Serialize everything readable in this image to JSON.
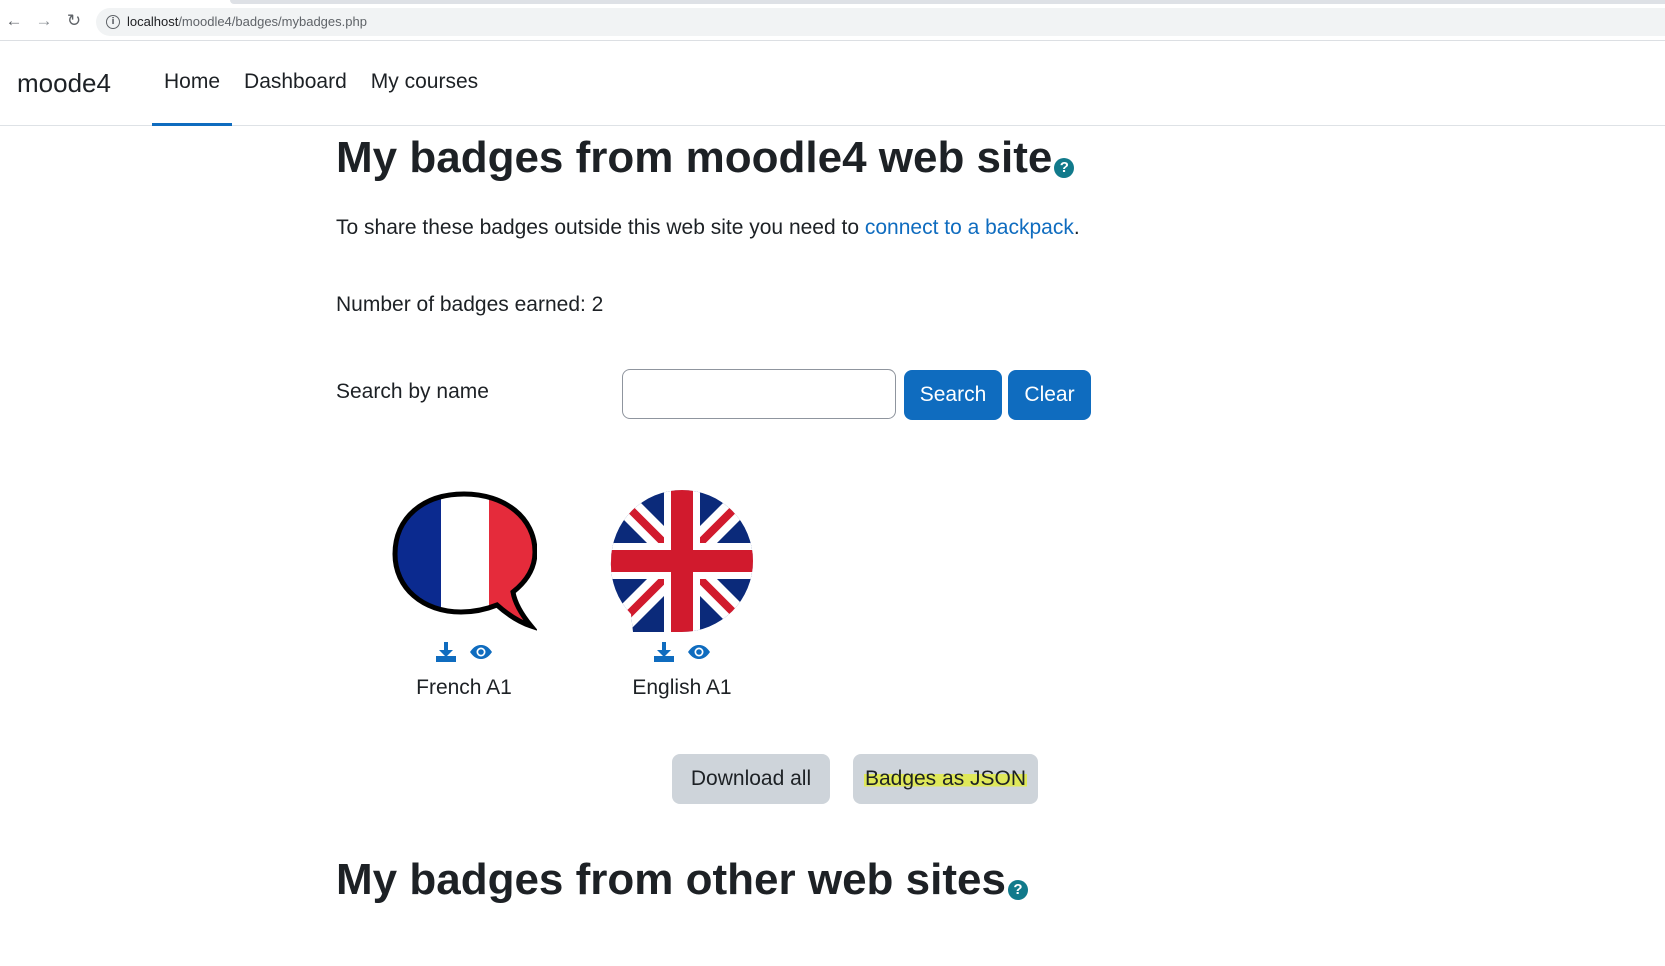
{
  "browser": {
    "url_host": "localhost",
    "url_path": "/moodle4/badges/mybadges.php"
  },
  "navbar": {
    "brand": "moode4",
    "links": [
      {
        "label": "Home",
        "active": true
      },
      {
        "label": "Dashboard",
        "active": false
      },
      {
        "label": "My courses",
        "active": false
      }
    ]
  },
  "main": {
    "heading": "My badges from moodle4 web site",
    "share_text": "To share these badges outside this web site you need to ",
    "share_link": "connect to a backpack",
    "share_end": ".",
    "earned_text": "Number of badges earned: 2",
    "search_label": "Search by name",
    "search_value": "",
    "search_button": "Search",
    "clear_button": "Clear",
    "badges": [
      {
        "name": "French A1",
        "image": "french-flag-speech-bubble",
        "actions": [
          "download-icon",
          "eye-icon"
        ]
      },
      {
        "name": "English A1",
        "image": "union-jack-circle",
        "actions": [
          "download-icon",
          "eye-icon"
        ]
      }
    ],
    "download_all_button": "Download all",
    "json_button": "Badges as JSON",
    "other_heading": "My badges from other web sites"
  },
  "colors": {
    "primary": "#0f6cbf",
    "secondary": "#ced4da",
    "highlight": "#dfe85a",
    "help_icon": "#117a8b"
  }
}
